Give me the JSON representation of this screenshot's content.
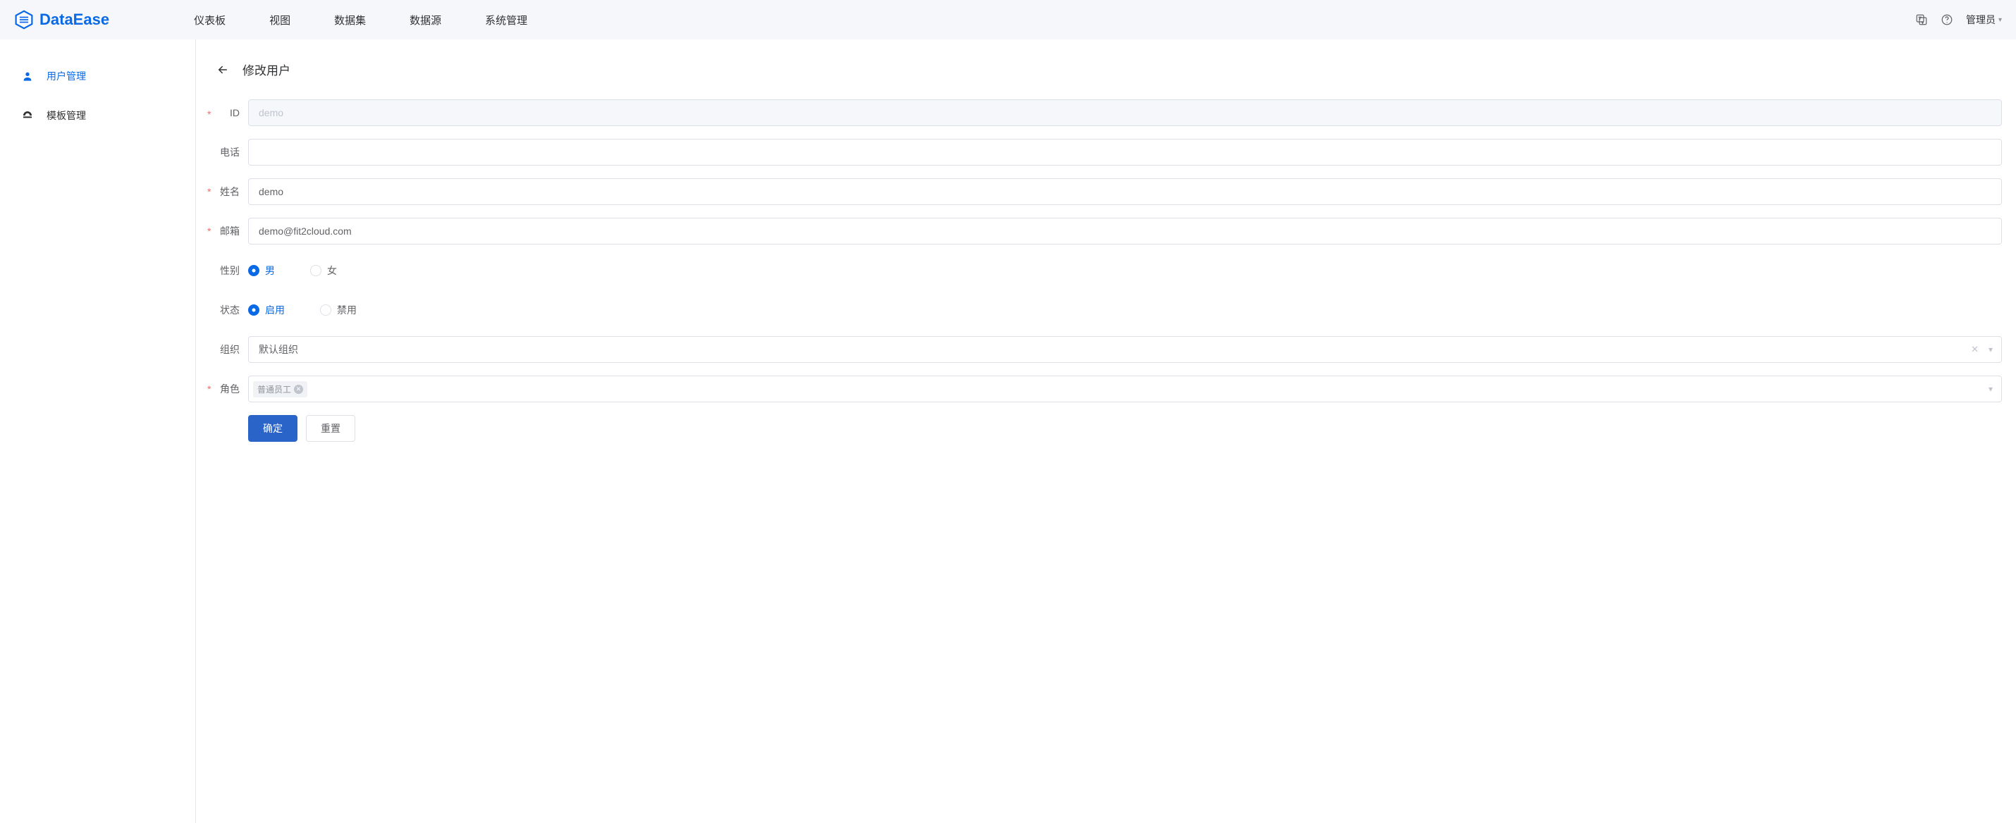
{
  "brand": {
    "name": "DataEase"
  },
  "nav": {
    "items": [
      "仪表板",
      "视图",
      "数据集",
      "数据源",
      "系统管理"
    ],
    "user_label": "管理员"
  },
  "sidebar": {
    "items": [
      {
        "label": "用户管理",
        "icon": "user-icon",
        "active": true
      },
      {
        "label": "模板管理",
        "icon": "dashboard-icon",
        "active": false
      }
    ]
  },
  "page": {
    "title": "修改用户"
  },
  "form": {
    "id": {
      "label": "ID",
      "value": "demo",
      "required": true,
      "disabled": true
    },
    "phone": {
      "label": "电话",
      "value": "",
      "required": false
    },
    "name": {
      "label": "姓名",
      "value": "demo",
      "required": true
    },
    "email": {
      "label": "邮箱",
      "value": "demo@fit2cloud.com",
      "required": true
    },
    "gender": {
      "label": "性别",
      "options": [
        "男",
        "女"
      ],
      "selected": "男"
    },
    "status": {
      "label": "状态",
      "options": [
        "启用",
        "禁用"
      ],
      "selected": "启用"
    },
    "org": {
      "label": "组织",
      "value": "默认组织"
    },
    "role": {
      "label": "角色",
      "tags": [
        "普通员工"
      ],
      "required": true
    },
    "submit_label": "确定",
    "reset_label": "重置"
  }
}
